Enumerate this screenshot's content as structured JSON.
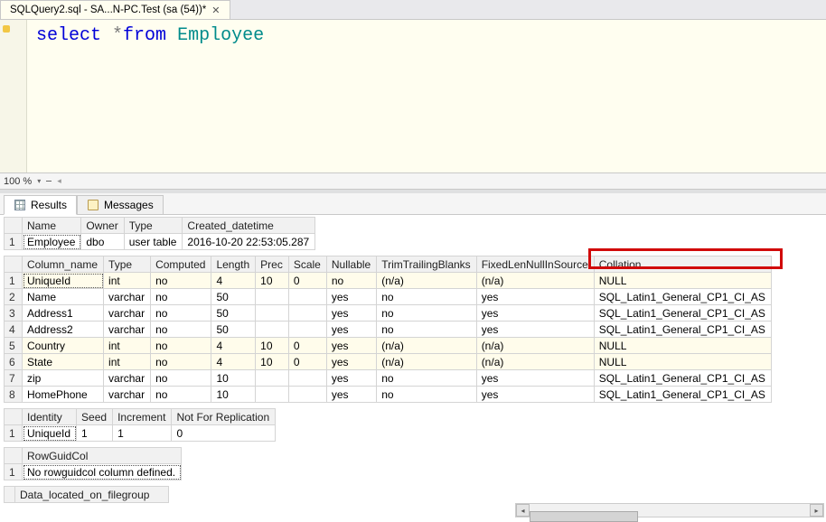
{
  "tab": {
    "title": "SQLQuery2.sql - SA...N-PC.Test (sa (54))*"
  },
  "code": {
    "select": "select",
    "star": "*",
    "from": "from",
    "ident": "Employee"
  },
  "zoom": {
    "level": "100 %"
  },
  "tabs": {
    "results": "Results",
    "messages": "Messages"
  },
  "grid1": {
    "headers": [
      "Name",
      "Owner",
      "Type",
      "Created_datetime"
    ],
    "row": [
      "Employee",
      "dbo",
      "user table",
      "2016-10-20 22:53:05.287"
    ]
  },
  "grid2": {
    "headers": [
      "Column_name",
      "Type",
      "Computed",
      "Length",
      "Prec",
      "Scale",
      "Nullable",
      "TrimTrailingBlanks",
      "FixedLenNullInSource",
      "Collation"
    ],
    "rows": [
      [
        "UniqueId",
        "int",
        "no",
        "4",
        "10",
        "0",
        "no",
        "(n/a)",
        "(n/a)",
        "NULL"
      ],
      [
        "Name",
        "varchar",
        "no",
        "50",
        "",
        "",
        "yes",
        "no",
        "yes",
        "SQL_Latin1_General_CP1_CI_AS"
      ],
      [
        "Address1",
        "varchar",
        "no",
        "50",
        "",
        "",
        "yes",
        "no",
        "yes",
        "SQL_Latin1_General_CP1_CI_AS"
      ],
      [
        "Address2",
        "varchar",
        "no",
        "50",
        "",
        "",
        "yes",
        "no",
        "yes",
        "SQL_Latin1_General_CP1_CI_AS"
      ],
      [
        "Country",
        "int",
        "no",
        "4",
        "10",
        "0",
        "yes",
        "(n/a)",
        "(n/a)",
        "NULL"
      ],
      [
        "State",
        "int",
        "no",
        "4",
        "10",
        "0",
        "yes",
        "(n/a)",
        "(n/a)",
        "NULL"
      ],
      [
        "zip",
        "varchar",
        "no",
        "10",
        "",
        "",
        "yes",
        "no",
        "yes",
        "SQL_Latin1_General_CP1_CI_AS"
      ],
      [
        "HomePhone",
        "varchar",
        "no",
        "10",
        "",
        "",
        "yes",
        "no",
        "yes",
        "SQL_Latin1_General_CP1_CI_AS"
      ]
    ]
  },
  "grid3": {
    "headers": [
      "Identity",
      "Seed",
      "Increment",
      "Not For Replication"
    ],
    "row": [
      "UniqueId",
      "1",
      "1",
      "0"
    ]
  },
  "grid4": {
    "headers": [
      "RowGuidCol"
    ],
    "row": [
      "No rowguidcol column defined."
    ]
  },
  "grid5": {
    "headers": [
      "Data_located_on_filegroup"
    ]
  }
}
